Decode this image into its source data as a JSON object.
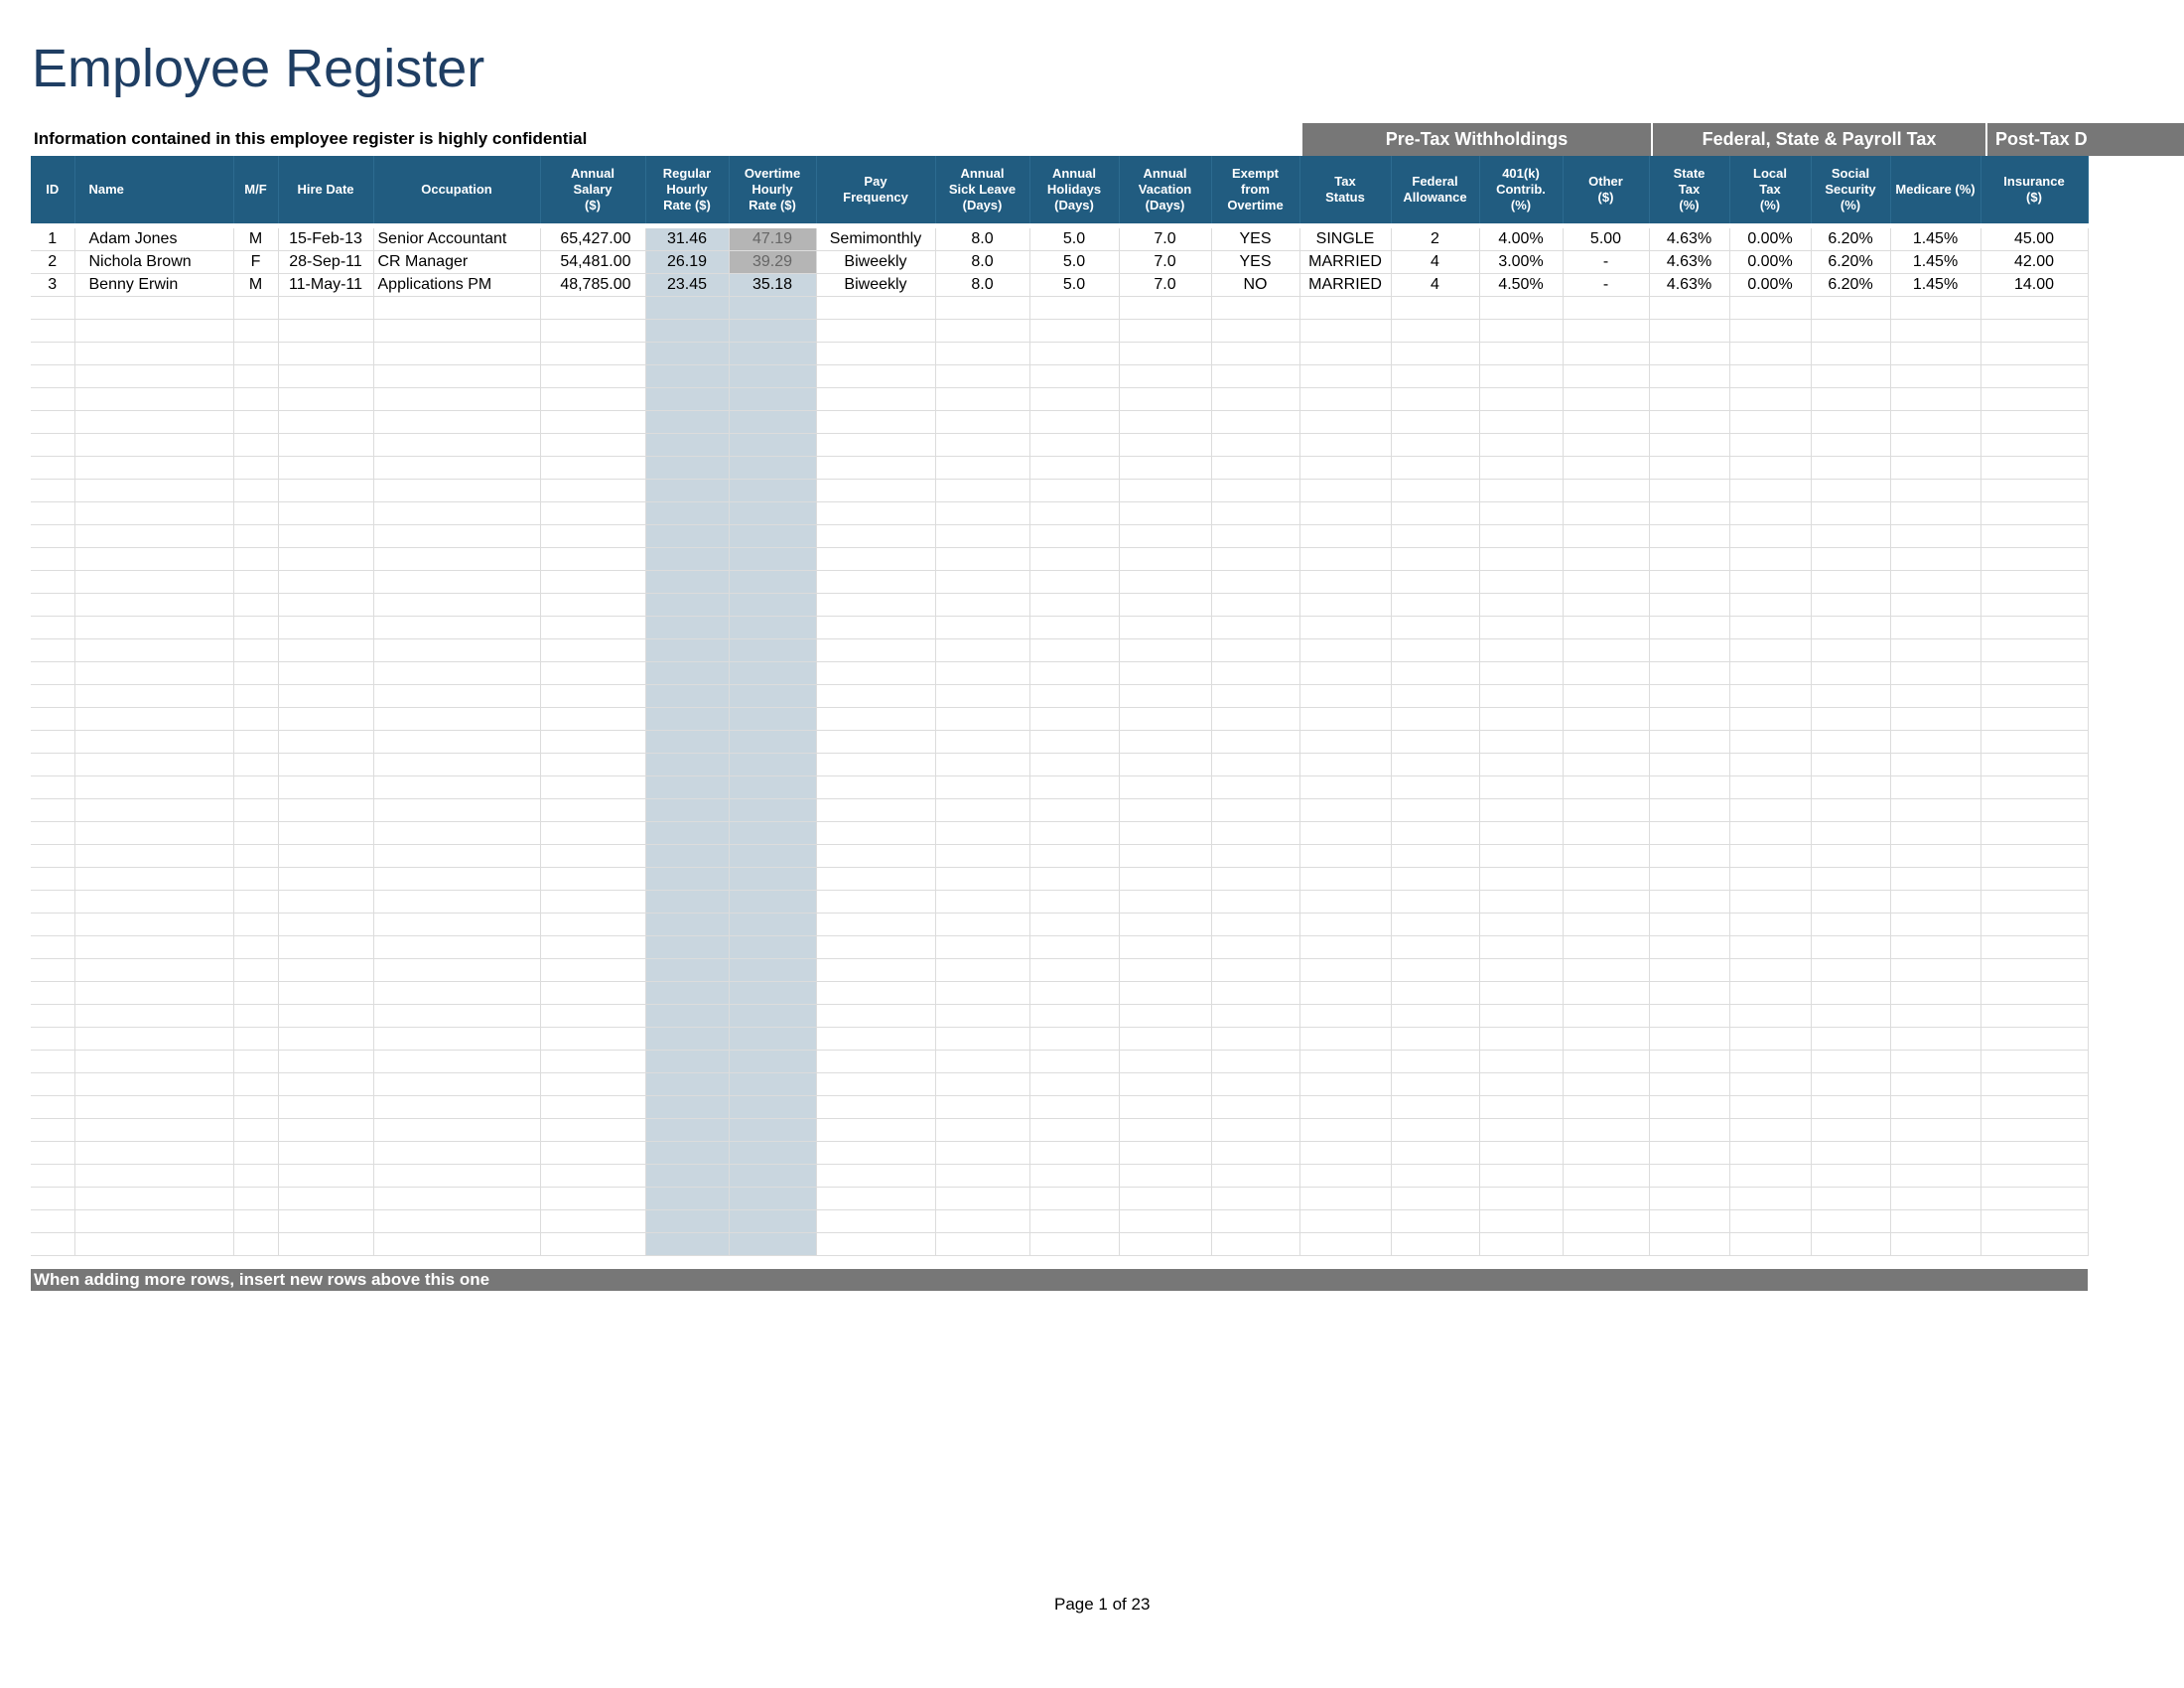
{
  "title": "Employee Register",
  "confidential_note": "Information contained in this employee register is highly confidential",
  "groups": {
    "pretax": "Pre-Tax Withholdings",
    "federal": "Federal, State & Payroll Tax",
    "posttax": "Post-Tax D"
  },
  "columns": [
    "ID",
    "Name",
    "M/F",
    "Hire Date",
    "Occupation",
    "Annual\nSalary\n($)",
    "Regular\nHourly\nRate ($)",
    "Overtime\nHourly\nRate ($)",
    "Pay\nFrequency",
    "Annual\nSick Leave\n(Days)",
    "Annual\nHolidays\n(Days)",
    "Annual\nVacation\n(Days)",
    "Exempt\nfrom\nOvertime",
    "Tax\nStatus",
    "Federal\nAllowance",
    "401(k)\nContrib.\n(%)",
    "Other\n($)",
    "State\nTax\n(%)",
    "Local\nTax\n(%)",
    "Social\nSecurity\n(%)",
    "Medicare (%)",
    "Insurance\n($)"
  ],
  "rows": [
    [
      "1",
      "Adam Jones",
      "M",
      "15-Feb-13",
      "Senior Accountant",
      "65,427.00",
      "31.46",
      "47.19",
      "Semimonthly",
      "8.0",
      "5.0",
      "7.0",
      "YES",
      "SINGLE",
      "2",
      "4.00%",
      "5.00",
      "4.63%",
      "0.00%",
      "6.20%",
      "1.45%",
      "45.00"
    ],
    [
      "2",
      "Nichola Brown",
      "F",
      "28-Sep-11",
      "CR Manager",
      "54,481.00",
      "26.19",
      "39.29",
      "Biweekly",
      "8.0",
      "5.0",
      "7.0",
      "YES",
      "MARRIED",
      "4",
      "3.00%",
      "-",
      "4.63%",
      "0.00%",
      "6.20%",
      "1.45%",
      "42.00"
    ],
    [
      "3",
      "Benny Erwin",
      "M",
      "11-May-11",
      "Applications PM",
      "48,785.00",
      "23.45",
      "35.18",
      "Biweekly",
      "8.0",
      "5.0",
      "7.0",
      "NO",
      "MARRIED",
      "4",
      "4.50%",
      "-",
      "4.63%",
      "0.00%",
      "6.20%",
      "1.45%",
      "14.00"
    ]
  ],
  "footer_note": "When adding more rows, insert new rows above this one",
  "page_number": "Page 1 of 23"
}
